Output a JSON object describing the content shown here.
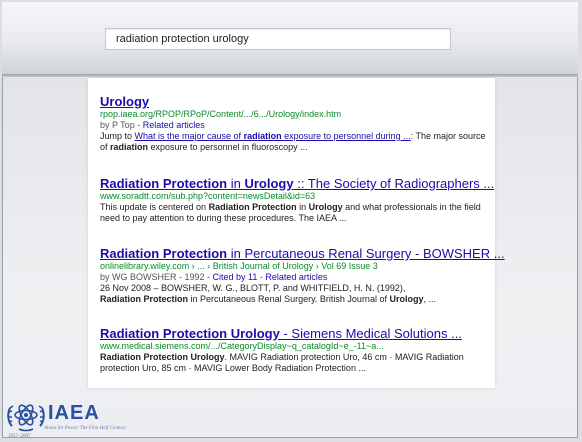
{
  "search": {
    "query": "radiation protection urology"
  },
  "results": [
    {
      "title_parts": [
        {
          "text": "Urology",
          "bold": false
        }
      ],
      "url": "rpop.iaea.org/RPOP/RPoP/Content/.../6.../Urology/index.htm",
      "meta": {
        "by": "by P Top - ",
        "related": "Related articles"
      },
      "snippet": {
        "prefix": "Jump to ",
        "link_pre": "What is the major cause of ",
        "link_bold": "radiation",
        "link_post": " exposure to personnel during ...",
        "mid": ": The major source of ",
        "bold1": "radiation",
        "post": " exposure to personnel in fluoroscopy ..."
      }
    },
    {
      "title": {
        "bold1": "Radiation Protection",
        "mid": " in ",
        "bold2": "Urology",
        "rest": " :: The Society of Radiographers ..."
      },
      "url": "www.soradtt.com/sub.php?content=newsDetail&id=63",
      "snippet": {
        "t1": "This update is centered on ",
        "b1": "Radiation Protection",
        "t2": " in ",
        "b2": "Urology",
        "t3": " and what professionals in the field need to pay attention to during these procedures. The IAEA ..."
      }
    },
    {
      "title": {
        "bold1": "Radiation Protection",
        "rest": " in Percutaneous Renal Surgery - BOWSHER ..."
      },
      "url": "onlinelibrary.wiley.com › ... › British Journal of Urology › Vol 69 Issue 3",
      "meta": {
        "by": "by WG BOWSHER - 1992 - ",
        "cited": "Cited by 11",
        "sep": " - ",
        "related": "Related articles"
      },
      "snippet": {
        "t1": "26 Nov 2008 – BOWSHER, W. G., BLOTT, P. and WHITFIELD, H. N. (1992),",
        "b1": "Radiation Protection",
        "t2": " in Percutaneous Renal Surgery. British Journal of ",
        "b2": "Urology",
        "t3": ", ..."
      }
    },
    {
      "title": {
        "bold1": "Radiation Protection Urology",
        "rest": " - Siemens Medical Solutions ..."
      },
      "url": "www.medical.siemens.com/.../CategoryDisplay~q_catalogId~e_-11~a...",
      "snippet": {
        "b1": "Radiation Protection Urology",
        "t1": ". MAVIG Radiation protection Uro, 46 cm · MAVIG Radiation protection Uro, 85 cm · MAVIG Lower Body Radiation Protection ..."
      }
    }
  ],
  "logo": {
    "word": "IAEA",
    "tagline": "Atoms for Peace: The First Half Century",
    "years": "1957–2007",
    "color": "#2a4fa3"
  }
}
